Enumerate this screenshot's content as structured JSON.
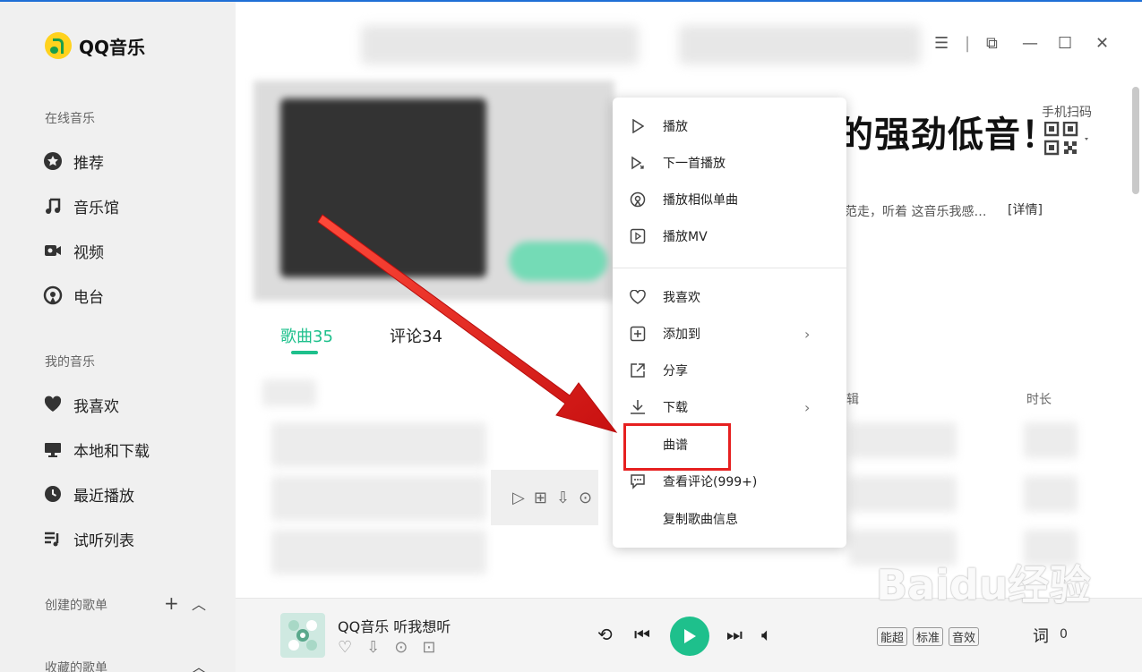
{
  "app": {
    "name": "QQ音乐"
  },
  "sidebar": {
    "online_label": "在线音乐",
    "online_items": [
      {
        "label": "推荐",
        "icon": "star-icon"
      },
      {
        "label": "音乐馆",
        "icon": "music-note-icon"
      },
      {
        "label": "视频",
        "icon": "video-icon"
      },
      {
        "label": "电台",
        "icon": "radio-icon"
      }
    ],
    "my_label": "我的音乐",
    "my_items": [
      {
        "label": "我喜欢",
        "icon": "heart-icon"
      },
      {
        "label": "本地和下载",
        "icon": "monitor-icon"
      },
      {
        "label": "最近播放",
        "icon": "clock-icon"
      },
      {
        "label": "试听列表",
        "icon": "playlist-icon"
      }
    ],
    "created_label": "创建的歌单",
    "collected_label": "收藏的歌单"
  },
  "main": {
    "title": "的强劲低音！",
    "scan_label": "手机扫码",
    "description": "范走，听着 这音乐我感…",
    "detail_link": "[详情]",
    "tabs": [
      {
        "label": "歌曲35"
      },
      {
        "label": "评论34"
      }
    ],
    "columns": {
      "album": "辑",
      "duration": "时长"
    }
  },
  "context_menu": {
    "items": [
      {
        "label": "播放",
        "icon": "play-outline-icon",
        "submenu": false
      },
      {
        "label": "下一首播放",
        "icon": "play-next-icon",
        "submenu": false
      },
      {
        "label": "播放相似单曲",
        "icon": "similar-radio-icon",
        "submenu": false
      },
      {
        "label": "播放MV",
        "icon": "mv-icon",
        "submenu": false
      },
      {
        "label": "我喜欢",
        "icon": "heart-outline-icon",
        "submenu": false
      },
      {
        "label": "添加到",
        "icon": "add-box-icon",
        "submenu": true
      },
      {
        "label": "分享",
        "icon": "share-icon",
        "submenu": false
      },
      {
        "label": "下载",
        "icon": "download-icon",
        "submenu": true
      },
      {
        "label": "曲谱",
        "icon": "",
        "submenu": false
      },
      {
        "label": "查看评论(999+)",
        "icon": "comment-icon",
        "submenu": false
      },
      {
        "label": "复制歌曲信息",
        "icon": "",
        "submenu": false
      }
    ]
  },
  "player": {
    "song": "QQ音乐 听我想听",
    "tags": [
      "能超",
      "标准",
      "音效"
    ],
    "lyric_label": "词",
    "queue_count": "0"
  },
  "watermark": "Baidu经验",
  "colors": {
    "accent": "#1ec08c",
    "highlight": "#e62020",
    "arrow": "#e8201b"
  }
}
